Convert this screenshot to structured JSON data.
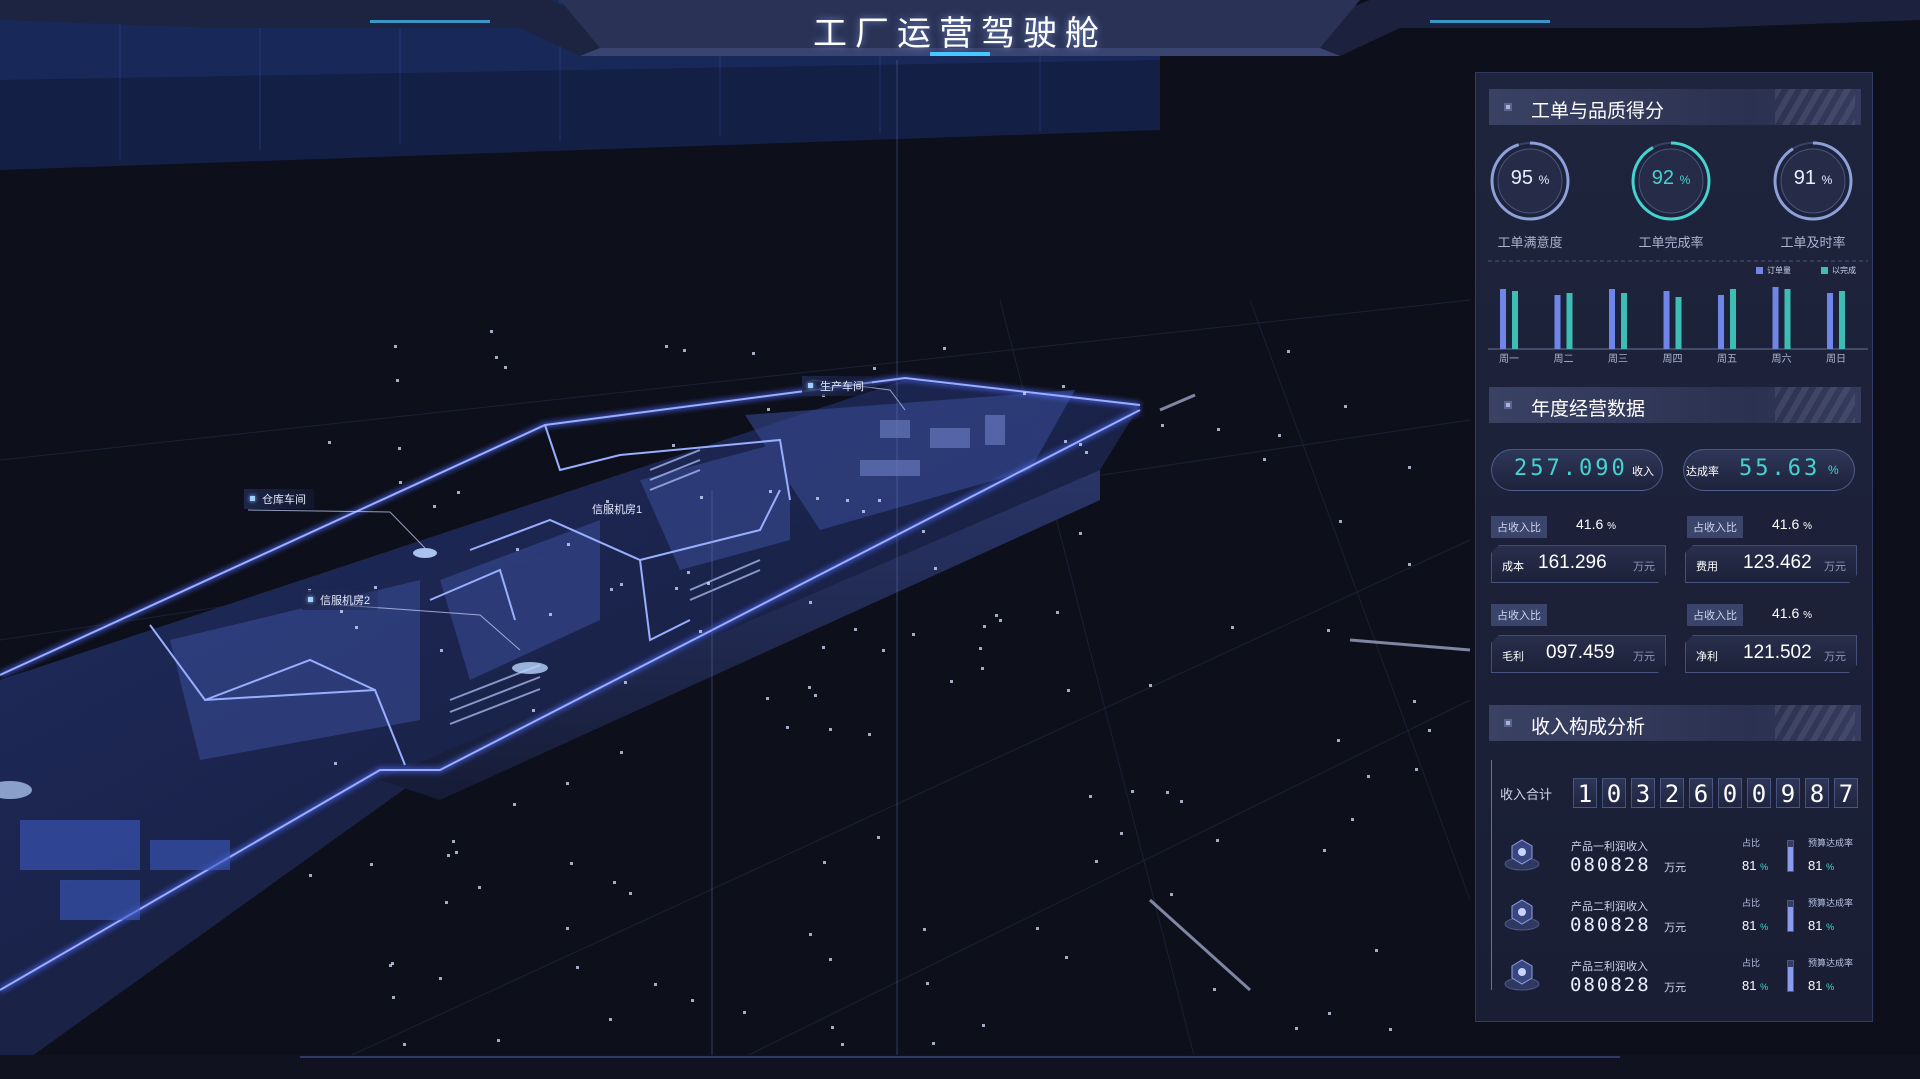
{
  "header": {
    "title": "工厂运营驾驶舱"
  },
  "scene": {
    "labels": {
      "warehouse": "仓库车间",
      "server_room_1": "信服机房1",
      "server_room_2": "信服机房2",
      "production_workshop": "生产车间"
    }
  },
  "work_order": {
    "title": "工单与品质得分",
    "gauges": [
      {
        "value": "95",
        "unit": "%",
        "label": "工单满意度",
        "fraction": 0.95
      },
      {
        "value": "92",
        "unit": "%",
        "label": "工单完成率",
        "fraction": 0.92
      },
      {
        "value": "91",
        "unit": "%",
        "label": "工单及时率",
        "fraction": 0.91
      }
    ],
    "legend": {
      "ordered": "订单量",
      "completed": "以完成"
    },
    "colors": {
      "ordered": "#6f86e8",
      "completed": "#3dbdb3"
    }
  },
  "chart_data": {
    "type": "bar",
    "categories": [
      "周一",
      "周二",
      "周三",
      "周四",
      "周五",
      "周六",
      "周日"
    ],
    "series": [
      {
        "name": "订单量",
        "values": [
          60,
          54,
          60,
          58,
          54,
          62,
          56
        ]
      },
      {
        "name": "以完成",
        "values": [
          58,
          56,
          56,
          52,
          60,
          60,
          58
        ]
      }
    ],
    "ylim": [
      0,
      70
    ]
  },
  "annual": {
    "title": "年度经营数据",
    "revenue": {
      "value": "257.090",
      "label": "收入"
    },
    "achievement": {
      "label": "达成率",
      "value": "55.63",
      "unit": "%"
    },
    "ratio_label": "占收入比",
    "ratios": [
      "41.6",
      "41.6",
      "41.6"
    ],
    "ratio_unit": "%",
    "cost": {
      "label": "成本",
      "value": "161.296",
      "unit": "万元"
    },
    "expense": {
      "label": "费用",
      "value": "123.462",
      "unit": "万元"
    },
    "gross": {
      "label": "毛利",
      "value": "097.459",
      "unit": "万元"
    },
    "net": {
      "label": "净利",
      "value": "121.502",
      "unit": "万元"
    }
  },
  "income": {
    "title": "收入构成分析",
    "total_label": "收入合计",
    "digits": [
      "1",
      "0",
      "3",
      "2",
      "6",
      "0",
      "0",
      "9",
      "8",
      "7"
    ],
    "share_label": "占比",
    "budget_label": "预算达成率",
    "products": [
      {
        "name": "产品一利润收入",
        "value": "080828",
        "unit": "万元",
        "share": "81",
        "budget": "81",
        "pct": "%"
      },
      {
        "name": "产品二利润收入",
        "value": "080828",
        "unit": "万元",
        "share": "81",
        "budget": "81",
        "pct": "%"
      },
      {
        "name": "产品三利润收入",
        "value": "080828",
        "unit": "万元",
        "share": "81",
        "budget": "81",
        "pct": "%"
      }
    ]
  }
}
